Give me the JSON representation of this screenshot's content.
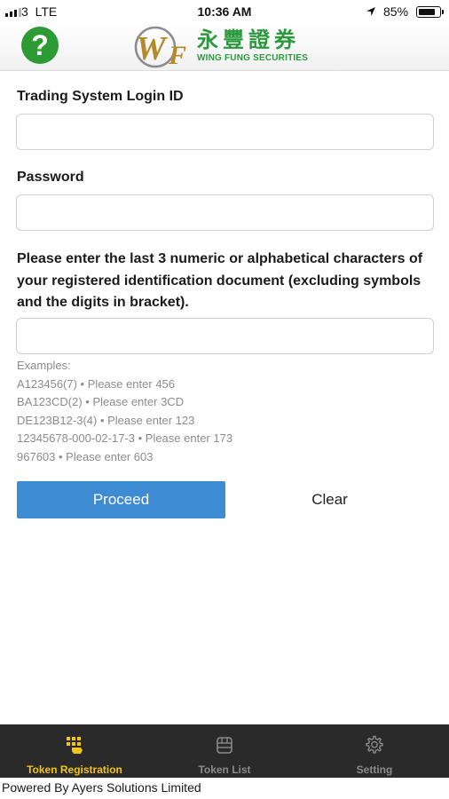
{
  "status_bar": {
    "carrier": "3",
    "network": "LTE",
    "time": "10:36 AM",
    "battery_percent": "85%",
    "battery_level": 0.85
  },
  "header": {
    "help_icon": "question-mark-icon",
    "logo": {
      "chinese": "永豐證券",
      "english": "WING FUNG SECURITIES",
      "mark_letters": "WF"
    }
  },
  "form": {
    "login_id_label": "Trading System Login ID",
    "login_id_value": "",
    "password_label": "Password",
    "password_value": "",
    "id_instruction": "Please enter the last 3 numeric or alphabetical characters of your registered identification document (excluding symbols and the digits in bracket).",
    "id_value": "",
    "examples_title": "Examples:",
    "examples": [
      "A123456(7) • Please enter 456",
      "BA123CD(2) • Please enter 3CD",
      "DE123B12-3(4) • Please enter 123",
      "12345678-000-02-17-3 • Please enter 173",
      "967603 • Please enter 603"
    ],
    "proceed_label": "Proceed",
    "clear_label": "Clear"
  },
  "tabs": [
    {
      "label": "Token Registration",
      "icon": "token-registration-icon",
      "active": true
    },
    {
      "label": "Token List",
      "icon": "token-list-icon",
      "active": false
    },
    {
      "label": "Setting",
      "icon": "gear-icon",
      "active": false
    }
  ],
  "footer": {
    "text": "Powered By Ayers Solutions Limited"
  },
  "colors": {
    "accent_blue": "#3d8bd3",
    "brand_green": "#2a9a3c",
    "brand_gold": "#b38b2a",
    "tab_active": "#f0c419",
    "tab_bar_bg": "#2a2a2a"
  }
}
